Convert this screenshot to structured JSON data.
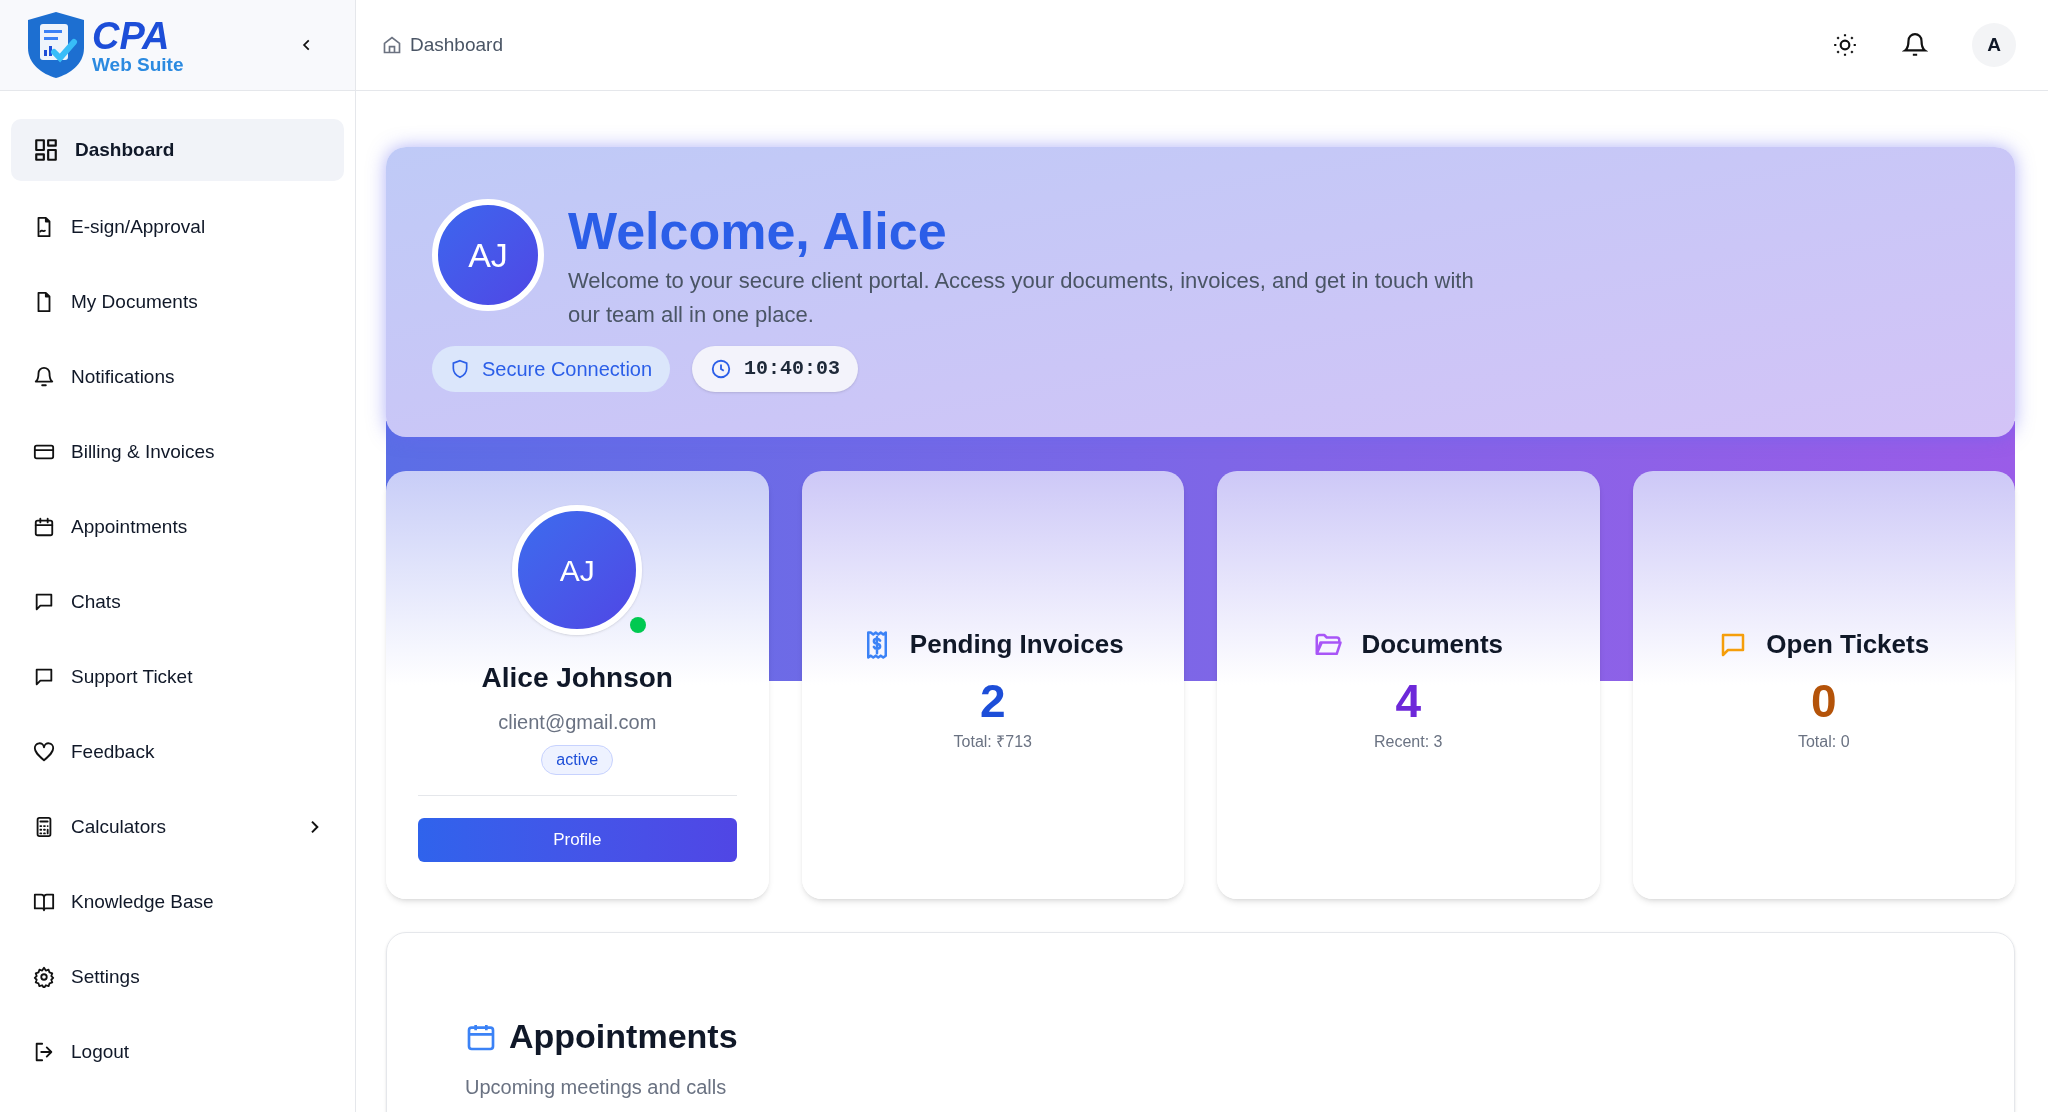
{
  "logo": {
    "title": "CPA",
    "subtitle": "Web Suite"
  },
  "sidebar": {
    "items": [
      {
        "label": "Dashboard",
        "selected": true,
        "kind": "link"
      },
      {
        "label": "E-sign/Approval",
        "selected": false,
        "kind": "link"
      },
      {
        "label": "My Documents",
        "selected": false,
        "kind": "link"
      },
      {
        "label": "Notifications",
        "selected": false,
        "kind": "link"
      },
      {
        "label": "Billing & Invoices",
        "selected": false,
        "kind": "link"
      },
      {
        "label": "Appointments",
        "selected": false,
        "kind": "link"
      },
      {
        "label": "Chats",
        "selected": false,
        "kind": "link"
      },
      {
        "label": "Support Ticket",
        "selected": false,
        "kind": "link"
      },
      {
        "label": "Feedback",
        "selected": false,
        "kind": "link"
      },
      {
        "label": "Calculators",
        "selected": false,
        "kind": "group"
      },
      {
        "label": "Knowledge Base",
        "selected": false,
        "kind": "link"
      },
      {
        "label": "Settings",
        "selected": false,
        "kind": "link"
      },
      {
        "label": "Logout",
        "selected": false,
        "kind": "link"
      }
    ]
  },
  "header": {
    "breadcrumb": "Dashboard",
    "avatar": "A"
  },
  "hero": {
    "initials": "AJ",
    "title": "Welcome, Alice",
    "text": "Welcome to your secure client portal. Access your documents, invoices, and get in touch with our team all in one place.",
    "secure_badge": "Secure Connection",
    "time": "10:40:03"
  },
  "profile": {
    "initials": "AJ",
    "online": true,
    "name": "Alice Johnson",
    "email": "client@gmail.com",
    "status": "active",
    "button": "Profile"
  },
  "stats": [
    {
      "title": "Pending Invoices",
      "value": "2",
      "note": "Total: ₹713",
      "color": "#1d4ed8"
    },
    {
      "title": "Documents",
      "value": "4",
      "note": "Recent: 3",
      "color": "#6d28d9"
    },
    {
      "title": "Open Tickets",
      "value": "0",
      "note": "Total: 0",
      "color": "#b45309"
    }
  ],
  "appointments": {
    "title": "Appointments",
    "subtitle": "Upcoming meetings and calls"
  }
}
